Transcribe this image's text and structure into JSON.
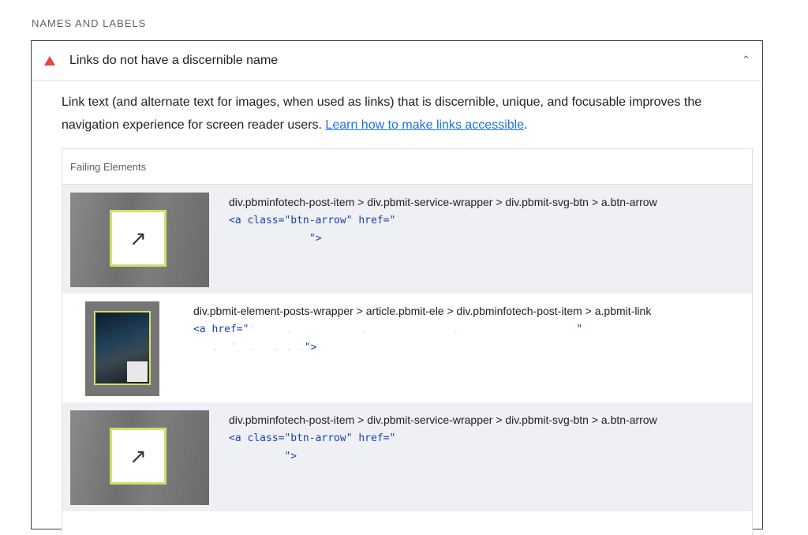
{
  "section": {
    "title": "NAMES AND LABELS"
  },
  "audit": {
    "title": "Links do not have a discernible name",
    "status_icon": "fail-triangle-icon",
    "status_color": "#e8453c",
    "collapse_icon": "chevron-up-icon",
    "description_text": "Link text (and alternate text for images, when used as links) that is discernible, unique, and focusable improves the navigation experience for screen reader users.",
    "learn_more_label": "Learn how to make links accessible",
    "description_end": "."
  },
  "table": {
    "header": "Failing Elements",
    "rows": [
      {
        "selector": "div.pbminfotech-post-item > div.pbmit-service-wrapper > div.pbmit-svg-btn > a.btn-arrow",
        "code_line1": "<a class=\"btn-arrow\" href=\"",
        "code_line2": "\">",
        "thumb_icon": "arrow-up-right-icon"
      },
      {
        "selector": "div.pbmit-element-posts-wrapper > article.pbmit-ele > div.pbminfotech-post-item > a.pbmit-link",
        "code_line1": "<a href=\"",
        "code_line1_tail": "\"",
        "code_line2": "\">"
      },
      {
        "selector": "div.pbminfotech-post-item > div.pbmit-service-wrapper > div.pbmit-svg-btn > a.btn-arrow",
        "code_line1": "<a class=\"btn-arrow\" href=\"",
        "code_line2": "\">",
        "thumb_icon": "arrow-up-right-icon"
      }
    ]
  },
  "glyphs": {
    "arrow": "↗",
    "chevron_up": "⌃"
  }
}
